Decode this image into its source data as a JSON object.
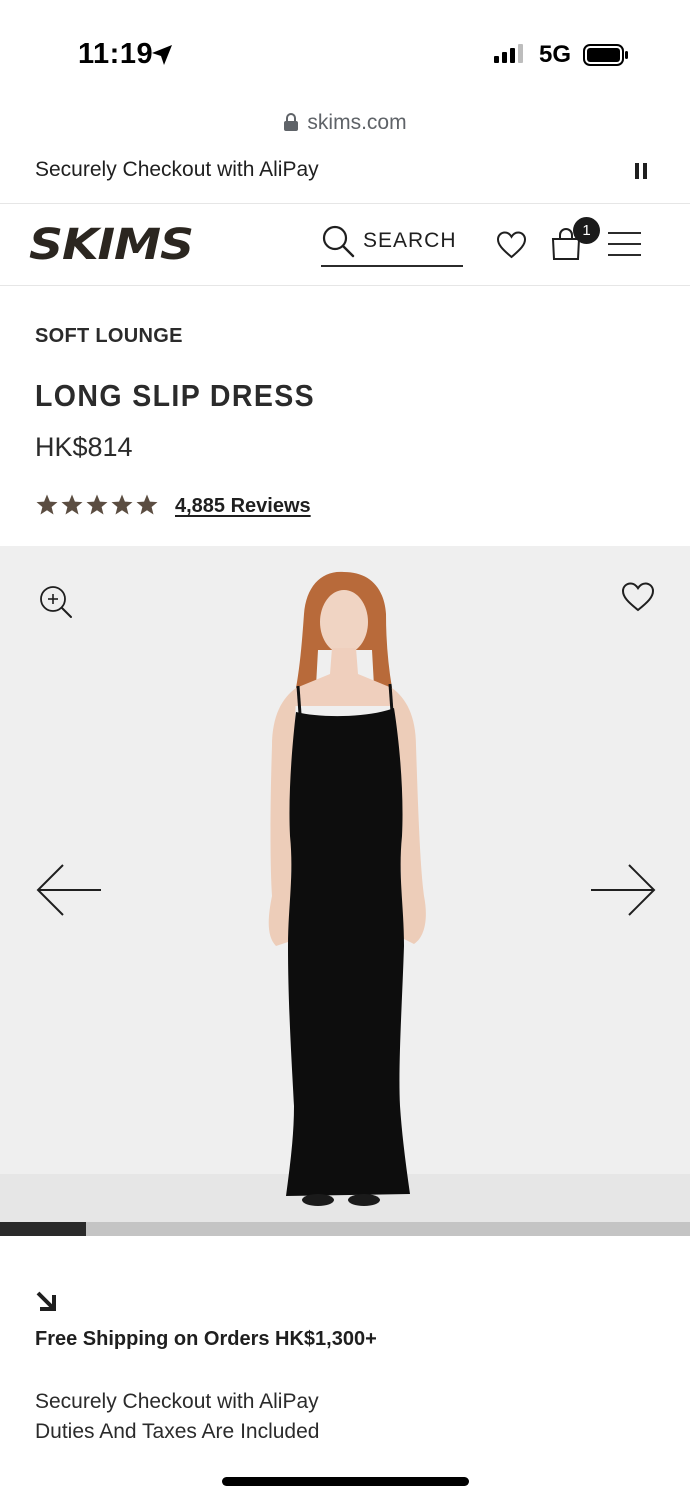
{
  "status_bar": {
    "time": "11:19",
    "network": "5G"
  },
  "browser": {
    "url": "skims.com"
  },
  "announcement": {
    "text": "Securely Checkout with AliPay"
  },
  "header": {
    "logo_text": "SKIMS",
    "search_label": "SEARCH",
    "cart_count": "1"
  },
  "product": {
    "category": "SOFT LOUNGE",
    "name": "LONG SLIP DRESS",
    "price": "HK$814",
    "rating": 5,
    "reviews_label": "4,885 Reviews"
  },
  "gallery": {
    "progress": 0.125
  },
  "promo": {
    "shipping": "Free Shipping on Orders HK$1,300+",
    "line1": "Securely Checkout with AliPay",
    "line2": "Duties And Taxes Are Included"
  },
  "colors": {
    "star": "#5b4d41",
    "text": "#1f1f1f",
    "gallery_bg": "#efefef"
  }
}
